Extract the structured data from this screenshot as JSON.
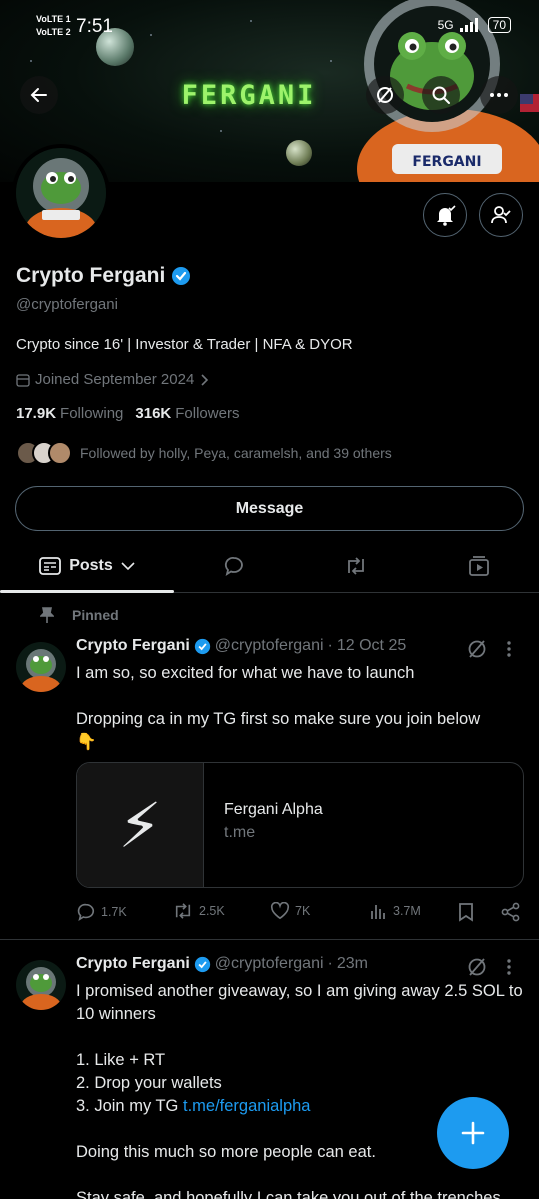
{
  "status_bar": {
    "time": "7:51",
    "volte_1": "VoLTE 1",
    "volte_2": "VoLTE 2",
    "network": "5G",
    "battery": "70"
  },
  "banner": {
    "title": "FERGANI"
  },
  "profile": {
    "display_name": "Crypto Fergani",
    "handle": "@cryptofergani",
    "bio": "Crypto since 16' | Investor & Trader | NFA & DYOR",
    "joined": "Joined September 2024",
    "following_count": "17.9K",
    "following_label": "Following",
    "followers_count": "316K",
    "followers_label": "Followers",
    "followed_by": "Followed by holly, Peya, caramelsh, and 39 others",
    "message_label": "Message"
  },
  "tabs": {
    "posts_label": "Posts"
  },
  "pinned_label": "Pinned",
  "tweets": [
    {
      "name": "Crypto Fergani",
      "handle": "@cryptofergani",
      "time": "12 Oct 25",
      "text": "I am so, so excited for what we have to launch\n\nDropping ca in my TG first so make sure you join below\n👇",
      "card": {
        "title": "Fergani Alpha",
        "domain": "t.me",
        "thumb": "⚡"
      },
      "replies": "1.7K",
      "reposts": "2.5K",
      "likes": "7K",
      "views": "3.7M"
    },
    {
      "name": "Crypto Fergani",
      "handle": "@cryptofergani",
      "time": "23m",
      "text_a": "I promised another giveaway, so I am giving away 2.5 SOL to 10 winners\n\n1. Like + RT\n2. Drop your wallets\n3. Join my TG ",
      "link": "t.me/ferganialpha",
      "text_b": "\n\nDoing this much so more people can eat.\n\nStay safe, and hopefully I can take you out of the trenches."
    }
  ],
  "colors": {
    "accent": "#1d9bf0",
    "muted": "#71767b",
    "border": "#2f3336",
    "text": "#e7e9ea"
  }
}
